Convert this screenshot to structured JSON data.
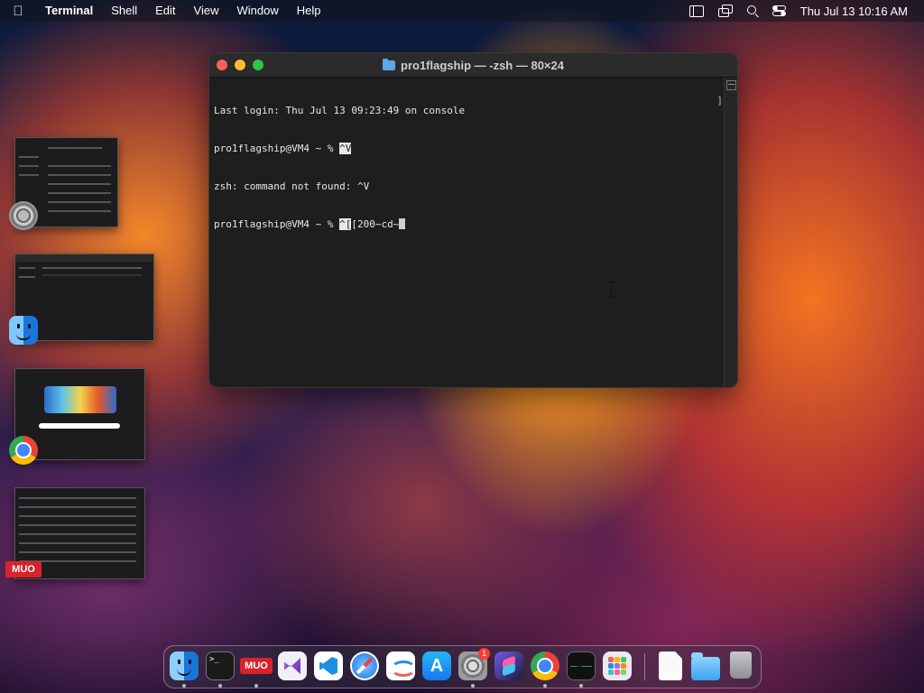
{
  "menubar": {
    "app_name": "Terminal",
    "items": [
      "Shell",
      "Edit",
      "View",
      "Window",
      "Help"
    ],
    "clock": "Thu Jul 13  10:16 AM",
    "icons": [
      "apple-icon",
      "sidebar-icon",
      "screen-mirroring-icon",
      "search-icon",
      "control-center-icon"
    ]
  },
  "terminal": {
    "title": "pro1flagship — -zsh — 80×24",
    "lines": [
      {
        "text": "Last login: Thu Jul 13 09:23:49 on console"
      },
      {
        "prompt": "pro1flagship@VM4 ~ % ",
        "highlight": "^V",
        "rest": ""
      },
      {
        "text": "zsh: command not found: ^V"
      },
      {
        "prompt": "pro1flagship@VM4 ~ % ",
        "highlight": "^[",
        "rest": "[200~cd~"
      }
    ]
  },
  "stage_manager": [
    {
      "app": "System Settings",
      "icon": "system-settings-icon"
    },
    {
      "app": "Finder",
      "icon": "finder-icon"
    },
    {
      "app": "Google Chrome",
      "icon": "chrome-icon",
      "doodle_text": "GOOGLE"
    },
    {
      "app": "MUO",
      "icon": "muo-icon",
      "label": "MUO"
    }
  ],
  "dock": {
    "items": [
      {
        "name": "Finder",
        "icon": "finder-icon"
      },
      {
        "name": "Terminal",
        "icon": "terminal-icon",
        "label": ">_"
      },
      {
        "name": "MUO",
        "icon": "muo-icon",
        "label": "MUO"
      },
      {
        "name": "Visual Studio",
        "icon": "visual-studio-icon"
      },
      {
        "name": "Visual Studio Code",
        "icon": "vscode-icon"
      },
      {
        "name": "Safari",
        "icon": "safari-icon"
      },
      {
        "name": "Freeform",
        "icon": "freeform-icon"
      },
      {
        "name": "App Store",
        "icon": "app-store-icon"
      },
      {
        "name": "System Settings",
        "icon": "system-settings-icon",
        "badge": "1"
      },
      {
        "name": "Shortcuts",
        "icon": "shortcuts-icon"
      },
      {
        "name": "Google Chrome",
        "icon": "chrome-icon"
      },
      {
        "name": "Activity Monitor",
        "icon": "activity-monitor-icon"
      },
      {
        "name": "Launchpad",
        "icon": "launchpad-icon"
      },
      {
        "name": "Document",
        "icon": "document-icon"
      },
      {
        "name": "Downloads",
        "icon": "folder-icon"
      },
      {
        "name": "Trash",
        "icon": "trash-icon"
      }
    ]
  }
}
